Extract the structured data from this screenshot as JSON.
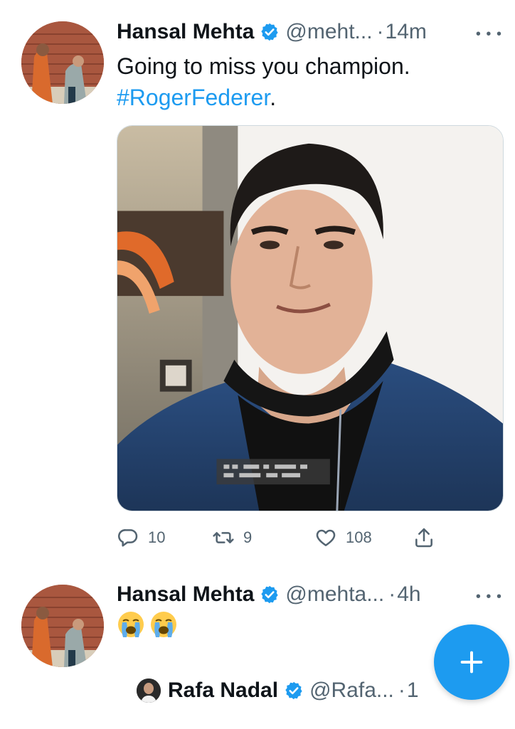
{
  "tweets": [
    {
      "author": "Hansal Mehta",
      "handle": "@meht...",
      "separator": "·",
      "time": "14m",
      "text": "Going to miss you champion.",
      "hashtag": "#RogerFederer",
      "hashtag_suffix": ".",
      "media_alt": "photo of a man in a navy jacket",
      "stats": {
        "replies": "10",
        "retweets": "9",
        "likes": "108"
      }
    },
    {
      "author": "Hansal Mehta",
      "handle": "@mehta...",
      "separator": "·",
      "time": "4h",
      "emojis": [
        "loudly-crying-face",
        "loudly-crying-face"
      ],
      "quoted": {
        "author": "Rafa Nadal",
        "handle": "@Rafa...",
        "separator": "·",
        "time": "1"
      }
    }
  ],
  "colors": {
    "accent": "#1d9bf0",
    "text": "#0f1419",
    "secondary": "#536471"
  },
  "icons": {
    "reply": "reply-icon",
    "retweet": "retweet-icon",
    "like": "heart-icon",
    "share": "share-icon",
    "more": "more-icon",
    "verified": "verified-badge-icon",
    "compose": "plus-icon"
  }
}
